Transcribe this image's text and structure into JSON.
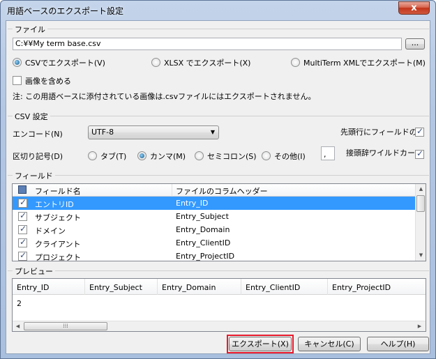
{
  "window": {
    "title": "用語ベースのエクスポート設定",
    "close_glyph": "x"
  },
  "file_group": {
    "label": "ファイル",
    "path": "C:¥¥My term base.csv",
    "browse_label": "...",
    "formats": [
      {
        "label": "CSVでエクスポート(V)",
        "selected": true
      },
      {
        "label": "XLSX でエクスポート(X)",
        "selected": false
      },
      {
        "label": "MultiTerm XMLでエクスポート(M)",
        "selected": false
      }
    ],
    "include_images_label": "画像を含める",
    "include_images": false,
    "note": "注: この用語ベースに添付されている画像は.csvファイルにはエクスポートされません。"
  },
  "csv_group": {
    "label": "CSV 設定",
    "encoding_label": "エンコード(N)",
    "encoding_value": "UTF-8",
    "first_row_label": "先頭行にフィールドの",
    "first_row_checked": true,
    "delimiter_label": "区切り記号(D)",
    "delimiters": [
      {
        "label": "タブ(T)",
        "selected": false
      },
      {
        "label": "カンマ(M)",
        "selected": true
      },
      {
        "label": "セミコロン(S)",
        "selected": false
      },
      {
        "label": "その他(I)",
        "selected": false
      }
    ],
    "other_value": ",",
    "wildcard_label": "接頭辞ワイルドカー",
    "wildcard_checked": true
  },
  "fields_group": {
    "label": "フィールド",
    "columns": [
      "フィールド名",
      "ファイルのコラムヘッダー"
    ],
    "rows": [
      {
        "name": "エントリID",
        "header": "Entry_ID",
        "checked": true,
        "selected": true
      },
      {
        "name": "サブジェクト",
        "header": "Entry_Subject",
        "checked": true,
        "selected": false
      },
      {
        "name": "ドメイン",
        "header": "Entry_Domain",
        "checked": true,
        "selected": false
      },
      {
        "name": "クライアント",
        "header": "Entry_ClientID",
        "checked": true,
        "selected": false
      },
      {
        "name": "プロジェクト",
        "header": "Entry_ProjectID",
        "checked": true,
        "selected": false
      }
    ]
  },
  "preview_group": {
    "label": "プレビュー",
    "columns": [
      "Entry_ID",
      "Entry_Subject",
      "Entry_Domain",
      "Entry_ClientID",
      "Entry_ProjectID"
    ],
    "rows": [
      [
        "2",
        "",
        "",
        "",
        ""
      ]
    ]
  },
  "buttons": {
    "export": "エクスポート(X)",
    "cancel": "キャンセル(C)",
    "help": "ヘルプ(H)"
  },
  "colors": {
    "selection": "#3399ff",
    "highlight_border": "#e8192c"
  }
}
